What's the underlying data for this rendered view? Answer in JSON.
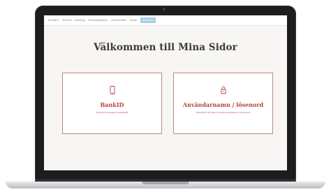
{
  "nav": {
    "items": [
      "Kurstjänst",
      "Ekonomi",
      "Betalning",
      "Resumégranskare",
      "Adminportalen",
      "Skapa",
      "Mina Sidor"
    ],
    "active_index": 6
  },
  "page": {
    "title": "Välkommen till Mina Sidor"
  },
  "cards": [
    {
      "title": "BankID",
      "subtitle": "Tryck här för att logga in med BankID",
      "icon": "phone-icon"
    },
    {
      "title": "Användarnamn / lösenord",
      "subtitle": "Klicka här för att logga in med ditt användarnamn och lösenord",
      "icon": "lock-icon"
    }
  ],
  "colors": {
    "accent": "#b3443a",
    "card_border": "#b98a82",
    "nav_active": "#a7cfe4",
    "screen_bg": "#f7f6f4"
  }
}
